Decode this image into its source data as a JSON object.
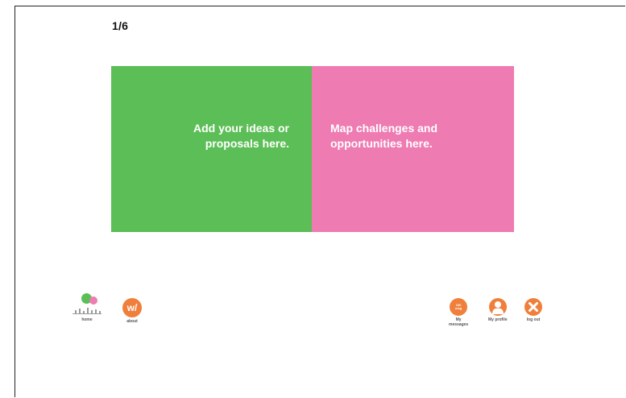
{
  "page_counter": "1/6",
  "panels": {
    "ideas": {
      "text": "Add your ideas or proposals here.",
      "color": "#5cbe56"
    },
    "challenges": {
      "text": "Map challenges and opportunities here.",
      "color": "#ee7bb1"
    }
  },
  "nav": {
    "home": {
      "label": "home",
      "icon": "home-icon"
    },
    "about": {
      "label": "about",
      "icon_text": "w/",
      "icon": "about-icon"
    },
    "messages": {
      "label": "My\nmessages",
      "icon_text": "100\nmsg",
      "icon": "messages-icon"
    },
    "profile": {
      "label": "My profile",
      "icon": "profile-icon"
    },
    "logout": {
      "label": "log out",
      "icon": "close-icon"
    }
  },
  "accent_color": "#f07f3b"
}
